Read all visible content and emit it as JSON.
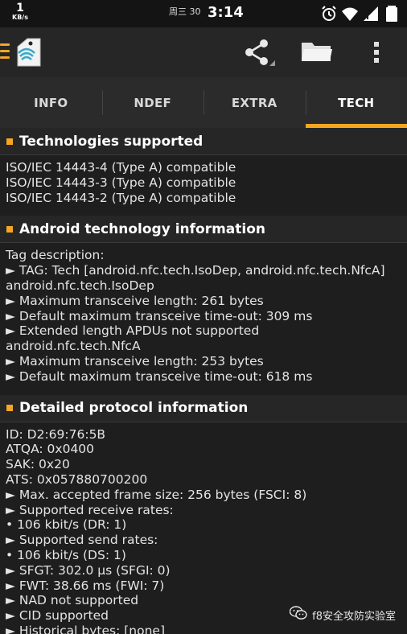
{
  "status_bar": {
    "net_speed": "1",
    "net_unit": "KB/s",
    "date": "周三 30",
    "time": "3:14"
  },
  "icons": {
    "menu": "hamburger-icon",
    "app": "nfc-tag-app-icon",
    "share": "share-icon",
    "folder": "folder-icon",
    "overflow": "more-vert-icon",
    "alarm": "alarm-icon",
    "wifi": "wifi-icon",
    "signal": "signal-icon",
    "battery": "battery-icon"
  },
  "colors": {
    "accent": "#f5a623",
    "background": "#1e1e1e",
    "header": "#262626"
  },
  "tabs": [
    {
      "label": "INFO",
      "active": false
    },
    {
      "label": "NDEF",
      "active": false
    },
    {
      "label": "EXTRA",
      "active": false
    },
    {
      "label": "TECH",
      "active": true
    }
  ],
  "sections": [
    {
      "title": "Technologies supported",
      "lines": [
        "ISO/IEC 14443-4 (Type A) compatible",
        "ISO/IEC 14443-3 (Type A) compatible",
        "ISO/IEC 14443-2 (Type A) compatible"
      ]
    },
    {
      "title": "Android technology information",
      "lines": [
        "Tag description:",
        "► TAG: Tech [android.nfc.tech.IsoDep, android.nfc.tech.NfcA]",
        "android.nfc.tech.IsoDep",
        "► Maximum transceive length: 261 bytes",
        "► Default maximum transceive time-out: 309   ms",
        "► Extended length APDUs not supported",
        "android.nfc.tech.NfcA",
        "► Maximum transceive length: 253 bytes",
        "► Default maximum transceive time-out: 618   ms"
      ]
    },
    {
      "title": "Detailed protocol information",
      "lines": [
        "ID: D2:69:76:5B",
        "ATQA: 0x0400",
        "SAK: 0x20",
        "ATS: 0x057880700200",
        "► Max. accepted frame size: 256 bytes (FSCI: 8)",
        "► Supported receive rates:",
        " • 106   kbit/s (DR: 1)",
        "► Supported send rates:",
        " • 106   kbit/s (DS: 1)",
        "► SFGT: 302.0   µs  (SFGI: 0)",
        "► FWT: 38.66   ms  (FWI: 7)",
        "► NAD not supported",
        "► CID supported",
        "► Historical bytes: [none]"
      ]
    }
  ],
  "watermark": "f8安全攻防实验室"
}
